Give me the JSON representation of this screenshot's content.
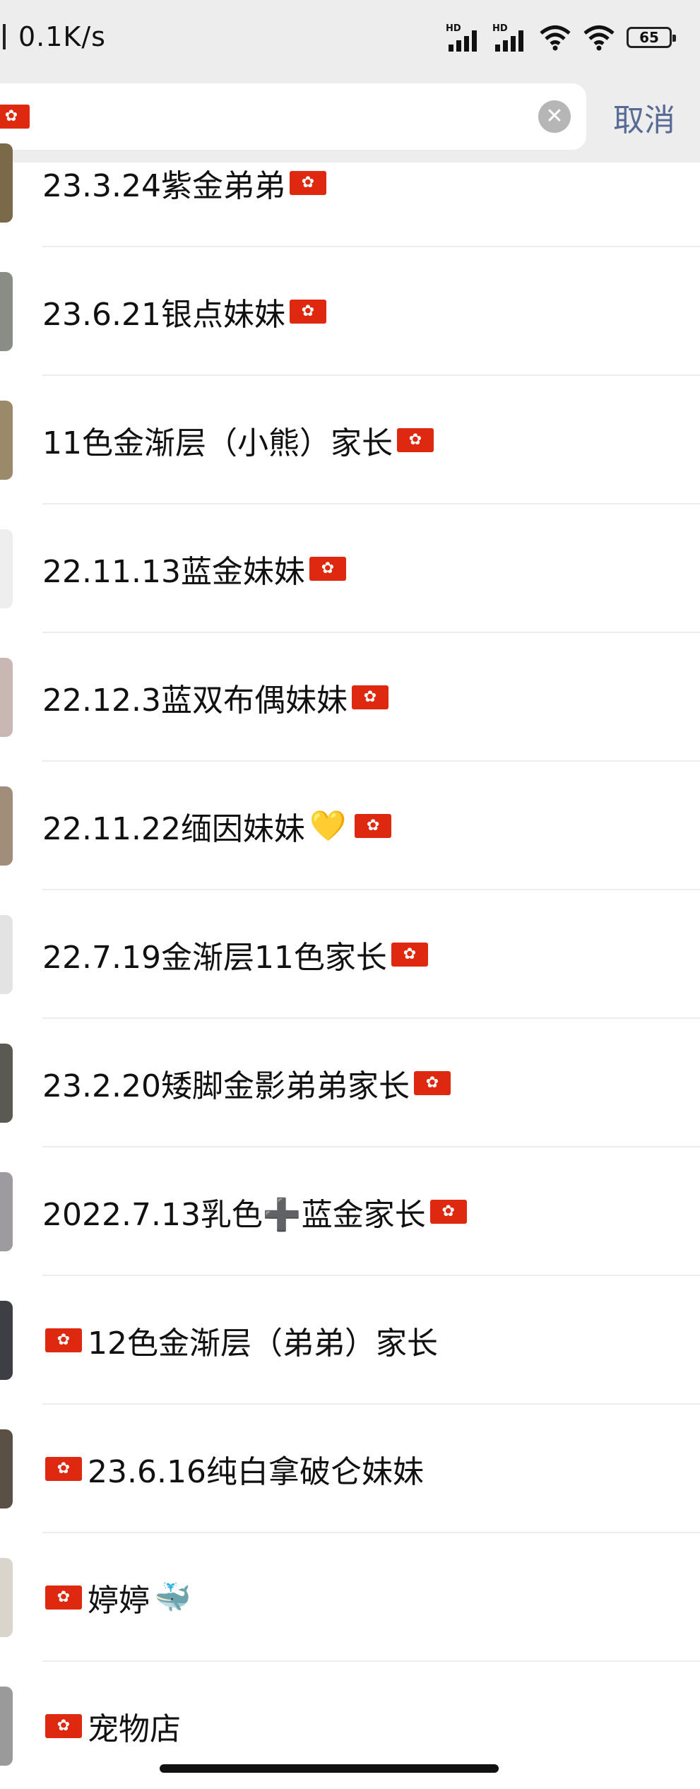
{
  "status_bar": {
    "net_speed": "0.1K/s",
    "signal1_label": "HD",
    "signal2_label": "HD",
    "battery": "65"
  },
  "search": {
    "cancel_label": "取消"
  },
  "contacts": [
    {
      "text": "23.3.24紫金弟弟",
      "lead_flag": false,
      "emoji": "",
      "trail_flag": true,
      "avatar_color": "#7a6a4a"
    },
    {
      "text": "23.6.21银点妹妹",
      "lead_flag": false,
      "emoji": "",
      "trail_flag": true,
      "avatar_color": "#8a8c86"
    },
    {
      "text": "11色金渐层（小熊）家长",
      "lead_flag": false,
      "emoji": "",
      "trail_flag": true,
      "avatar_color": "#9b8a6a"
    },
    {
      "text": "22.11.13蓝金妹妹",
      "lead_flag": false,
      "emoji": "",
      "trail_flag": true,
      "avatar_color": "#eeeeee"
    },
    {
      "text": "22.12.3蓝双布偶妹妹",
      "lead_flag": false,
      "emoji": "",
      "trail_flag": true,
      "avatar_color": "#c9b7b3"
    },
    {
      "text": "22.11.22缅因妹妹",
      "lead_flag": false,
      "emoji": "💛",
      "trail_flag": true,
      "avatar_color": "#a08d7a"
    },
    {
      "text": "22.7.19金渐层11色家长",
      "lead_flag": false,
      "emoji": "",
      "trail_flag": true,
      "avatar_color": "#e3e3e3"
    },
    {
      "text": "23.2.20矮脚金影弟弟家长",
      "lead_flag": false,
      "emoji": "",
      "trail_flag": true,
      "avatar_color": "#5a5a52"
    },
    {
      "text": "2022.7.13乳色➕蓝金家长",
      "lead_flag": false,
      "emoji": "",
      "trail_flag": true,
      "avatar_color": "#9d9aa0"
    },
    {
      "text": "12色金渐层（弟弟）家长",
      "lead_flag": true,
      "emoji": "",
      "trail_flag": false,
      "avatar_color": "#3e3f44"
    },
    {
      "text": "23.6.16纯白拿破仑妹妹",
      "lead_flag": true,
      "emoji": "",
      "trail_flag": false,
      "avatar_color": "#5b5045"
    },
    {
      "text": "婷婷",
      "lead_flag": true,
      "emoji": "🐳",
      "trail_flag": false,
      "avatar_color": "#d9d4cc"
    },
    {
      "text": "宠物店",
      "lead_flag": true,
      "emoji": "",
      "trail_flag": false,
      "avatar_color": "#9a9a9a"
    }
  ]
}
